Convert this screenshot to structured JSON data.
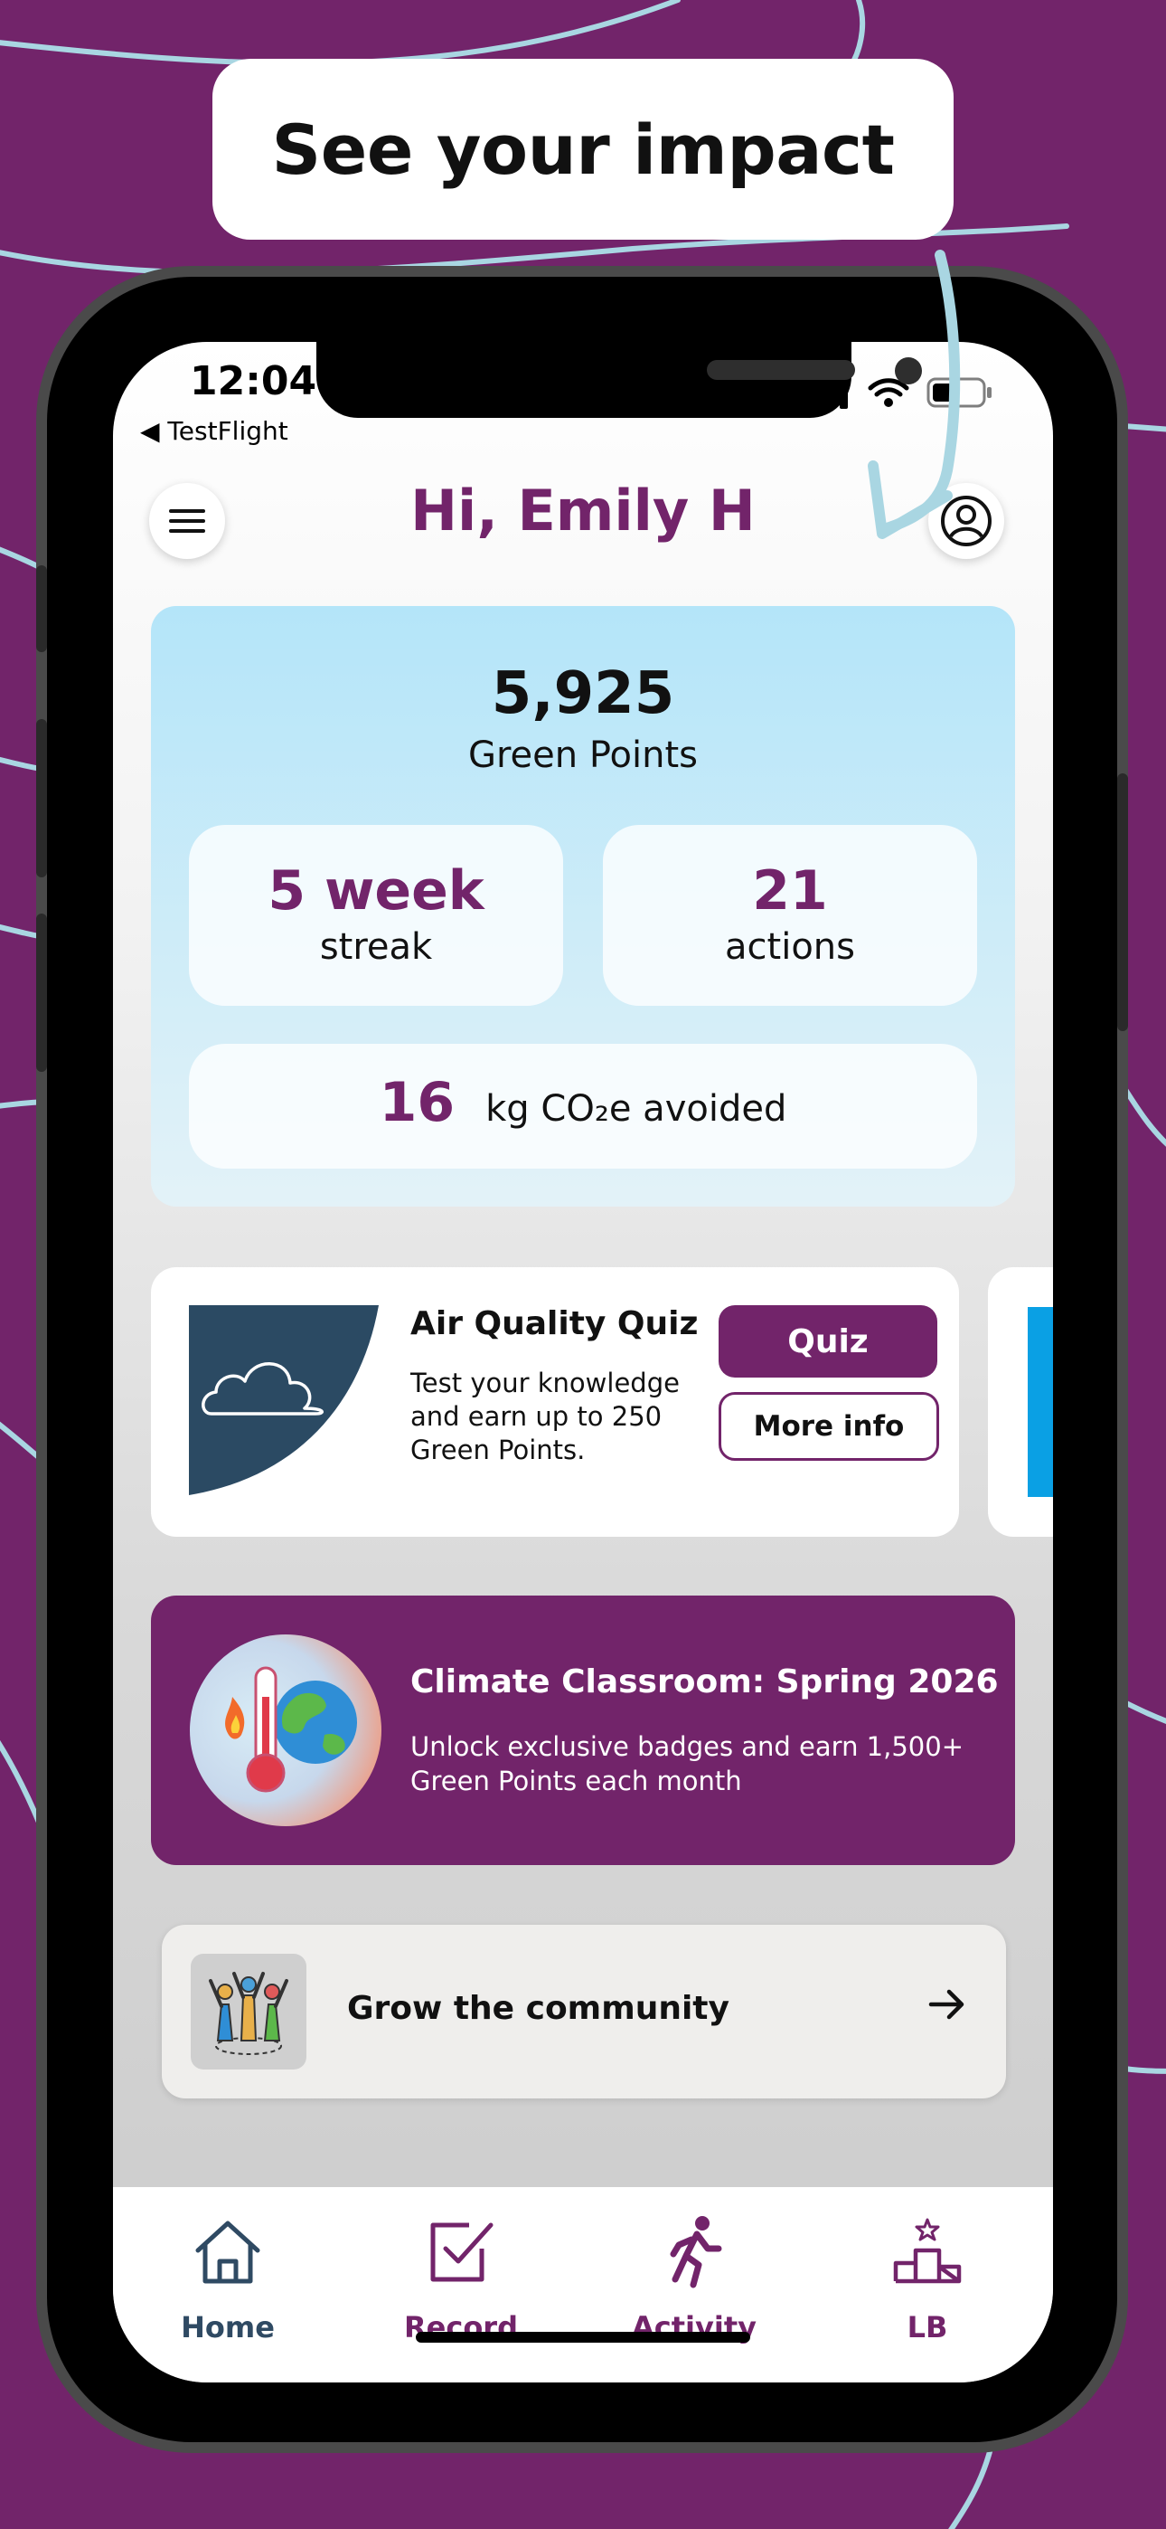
{
  "headline": "See your impact",
  "status_bar": {
    "time": "12:04",
    "back_label": "◀ TestFlight"
  },
  "header": {
    "greeting": "Hi, Emily H",
    "menu_icon": "hamburger-menu-icon",
    "profile_icon": "user-profile-icon"
  },
  "stats": {
    "points_value": "5,925",
    "points_label": "Green Points",
    "streak_value": "5 week",
    "streak_label": "streak",
    "actions_value": "21",
    "actions_label": "actions",
    "co2_value": "16",
    "co2_label": "kg CO₂e avoided"
  },
  "quiz_card": {
    "title": "Air Quality Quiz",
    "description": "Test your knowledge and earn up to 250 Green Points.",
    "primary_button": "Quiz",
    "secondary_button": "More info",
    "thumbnail_icon": "cloud-icon"
  },
  "climate_card": {
    "title": "Climate Classroom: Spring 2026",
    "description": "Unlock exclusive badges and earn 1,500+ Green Points each month",
    "icon": "thermometer-earth-icon"
  },
  "community_card": {
    "label": "Grow the community",
    "icon": "community-people-icon",
    "arrow_icon": "arrow-right-icon"
  },
  "tabbar": {
    "tabs": [
      {
        "label": "Home",
        "icon": "home-icon",
        "color": "#2f4a63"
      },
      {
        "label": "Record",
        "icon": "checkbox-icon",
        "color": "#72246a"
      },
      {
        "label": "Activity",
        "icon": "running-person-icon",
        "color": "#72246a"
      },
      {
        "label": "LB",
        "icon": "podium-icon",
        "color": "#72246a"
      }
    ]
  },
  "colors": {
    "brand_purple": "#72246a",
    "stats_blue": "#b4e5f9",
    "curve_blue": "#a9d6e2",
    "home_navy": "#2f4a63"
  }
}
